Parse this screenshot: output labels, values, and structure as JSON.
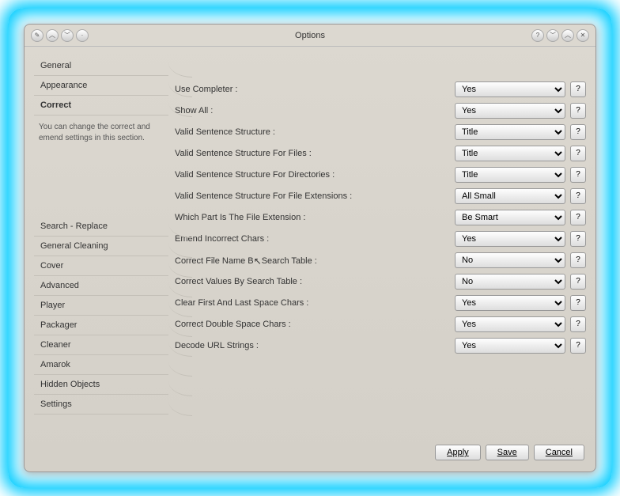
{
  "title": "Options",
  "sidebar": {
    "top": [
      {
        "label": "General"
      },
      {
        "label": "Appearance"
      },
      {
        "label": "Correct"
      }
    ],
    "desc": "You can change the correct and emend settings in this section.",
    "bottom": [
      {
        "label": "Search - Replace"
      },
      {
        "label": "General Cleaning"
      },
      {
        "label": "Cover"
      },
      {
        "label": "Advanced"
      },
      {
        "label": "Player"
      },
      {
        "label": "Packager"
      },
      {
        "label": "Cleaner"
      },
      {
        "label": "Amarok"
      },
      {
        "label": "Hidden Objects"
      },
      {
        "label": "Settings"
      }
    ]
  },
  "rows": [
    {
      "label": "Use Completer :",
      "value": "Yes"
    },
    {
      "label": "Show All :",
      "value": "Yes"
    },
    {
      "label": "Valid Sentence Structure :",
      "value": "Title"
    },
    {
      "label": "Valid Sentence Structure For Files :",
      "value": "Title"
    },
    {
      "label": "Valid Sentence Structure For Directories :",
      "value": "Title"
    },
    {
      "label": "Valid Sentence Structure For File Extensions :",
      "value": "All Small"
    },
    {
      "label": "Which Part Is The File Extension :",
      "value": "Be Smart"
    },
    {
      "label": "Emend Incorrect Chars :",
      "value": "Yes"
    },
    {
      "label": "Correct File Name By Search Table :",
      "value": "No",
      "cursor": true
    },
    {
      "label": "Correct Values By Search Table :",
      "value": "No"
    },
    {
      "label": "Clear First And Last Space Chars :",
      "value": "Yes"
    },
    {
      "label": "Correct Double Space Chars :",
      "value": "Yes"
    },
    {
      "label": "Decode URL Strings :",
      "value": "Yes"
    }
  ],
  "footer": {
    "apply": "Apply",
    "save": "Save",
    "cancel": "Cancel"
  },
  "help": "?"
}
